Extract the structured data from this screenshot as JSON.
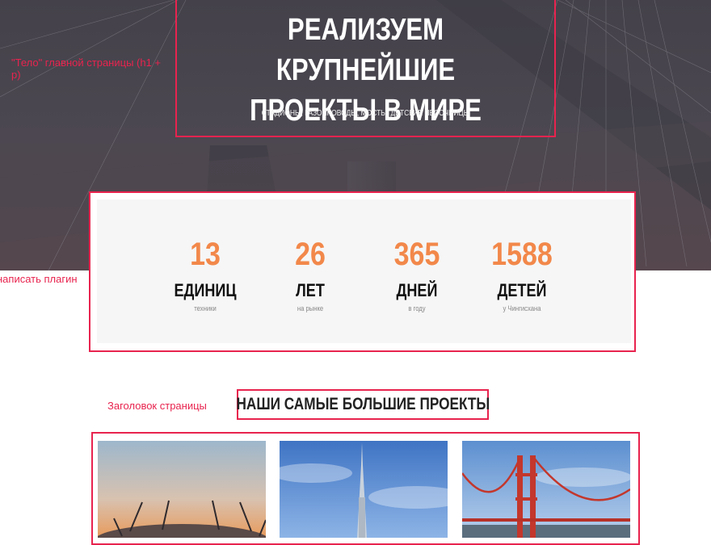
{
  "annotations": {
    "hero": "\"Тело\" главной страницы (h1 + p)",
    "plugin": "написать плагин",
    "heading": "Заголовок страницы"
  },
  "hero": {
    "title_line1": "РЕАЛИЗУЕМ КРУПНЕЙШИЕ",
    "title_line2": "ПРОЕКТЫ В МИРЕ",
    "subtitle": "СТАДИОНЫ, ГАЗОПРОВОДЫ, МОСТЫ, ДЕТСКИЕ ПЕСОЧНИЦЫ"
  },
  "stats": [
    {
      "number": "13",
      "label": "ЕДИНИЦ",
      "sub": "техники"
    },
    {
      "number": "26",
      "label": "ЛЕТ",
      "sub": "на рынке"
    },
    {
      "number": "365",
      "label": "ДНЕЙ",
      "sub": "в году"
    },
    {
      "number": "1588",
      "label": "ДЕТЕЙ",
      "sub": "у Чингисхана"
    }
  ],
  "projects": {
    "heading": "НАШИ САМЫЕ БОЛЬШИЕ ПРОЕКТЫ",
    "items": [
      {
        "image": "stadium-photo"
      },
      {
        "image": "skyscraper-photo"
      },
      {
        "image": "red-bridge-photo"
      }
    ]
  },
  "colors": {
    "annotation": "#e8234e",
    "accent": "#f2884a",
    "hero_bg": "#4a4650"
  }
}
